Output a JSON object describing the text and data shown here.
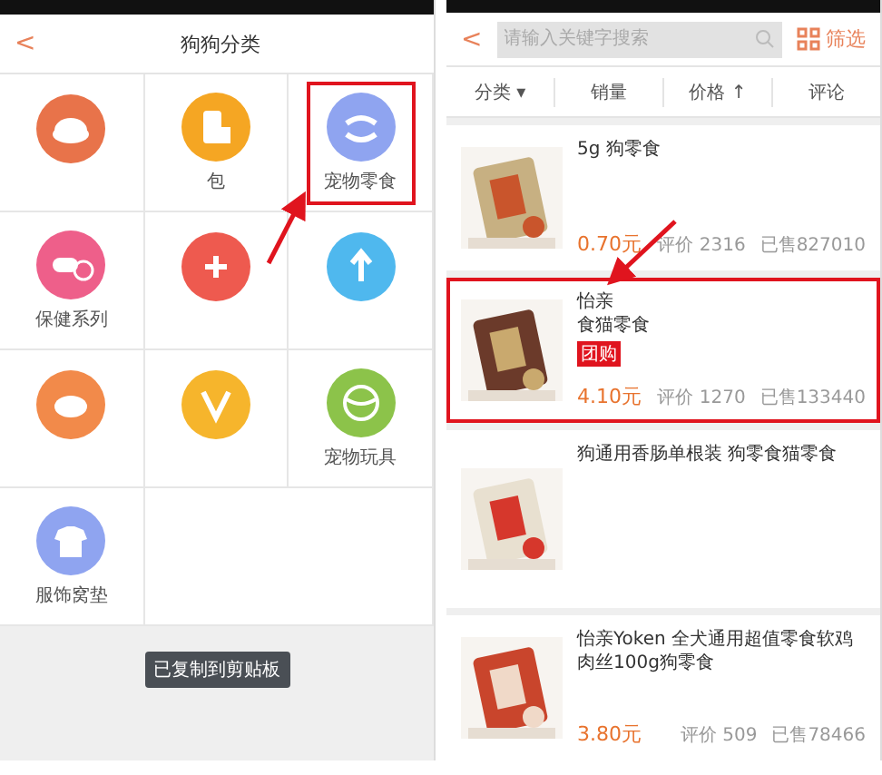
{
  "left_screen": {
    "title": "狗狗分类",
    "back": "<",
    "categories": [
      {
        "color": "#e8734a",
        "selected": false
      },
      {
        "label": "包",
        "color": "#f5a623",
        "selected": false
      },
      {
        "label": "宠物零食",
        "color": "#8fa4f0",
        "selected": true
      },
      {
        "label": "保健系列",
        "color": "#ee5f8a",
        "selected": false
      },
      {
        "color": "#ee5a4f",
        "selected": false
      },
      {
        "color": "#4fb8ee",
        "selected": false
      },
      {
        "color": "#f28a4a",
        "selected": false
      },
      {
        "color": "#f6b52c",
        "selected": false
      },
      {
        "label": "宠物玩具",
        "color": "#8cc34a",
        "selected": false
      },
      {
        "label": "服饰窝垫",
        "color": "#8fa4f0",
        "selected": false
      }
    ],
    "toast": "已复制到剪贴板"
  },
  "right_screen": {
    "back": "<",
    "search": {
      "placeholder": "请输入关键字搜索"
    },
    "filter": "筛选",
    "sort_tabs": [
      {
        "label": "分类",
        "mark": "▾"
      },
      {
        "label": "销量"
      },
      {
        "label": "价格",
        "mark": "↑"
      },
      {
        "label": "评论"
      }
    ],
    "products": [
      {
        "title": "5g 狗零食",
        "price": "0.70元",
        "reviews": "评价 2316",
        "sold": "已售827010",
        "selected": false
      },
      {
        "title": "怡亲",
        "subtitle": "食猫零食",
        "badge": "团购",
        "price": "4.10元",
        "reviews": "评价 1270",
        "sold": "已售133440",
        "selected": true
      },
      {
        "title": "狗通用香肠单根装 狗零食猫零食",
        "selected": false
      },
      {
        "title": "怡亲Yoken 全犬通用超值零食软鸡肉丝100g狗零食",
        "price": "3.80元",
        "reviews": "评价 509",
        "sold": "已售78466",
        "selected": false
      }
    ]
  }
}
